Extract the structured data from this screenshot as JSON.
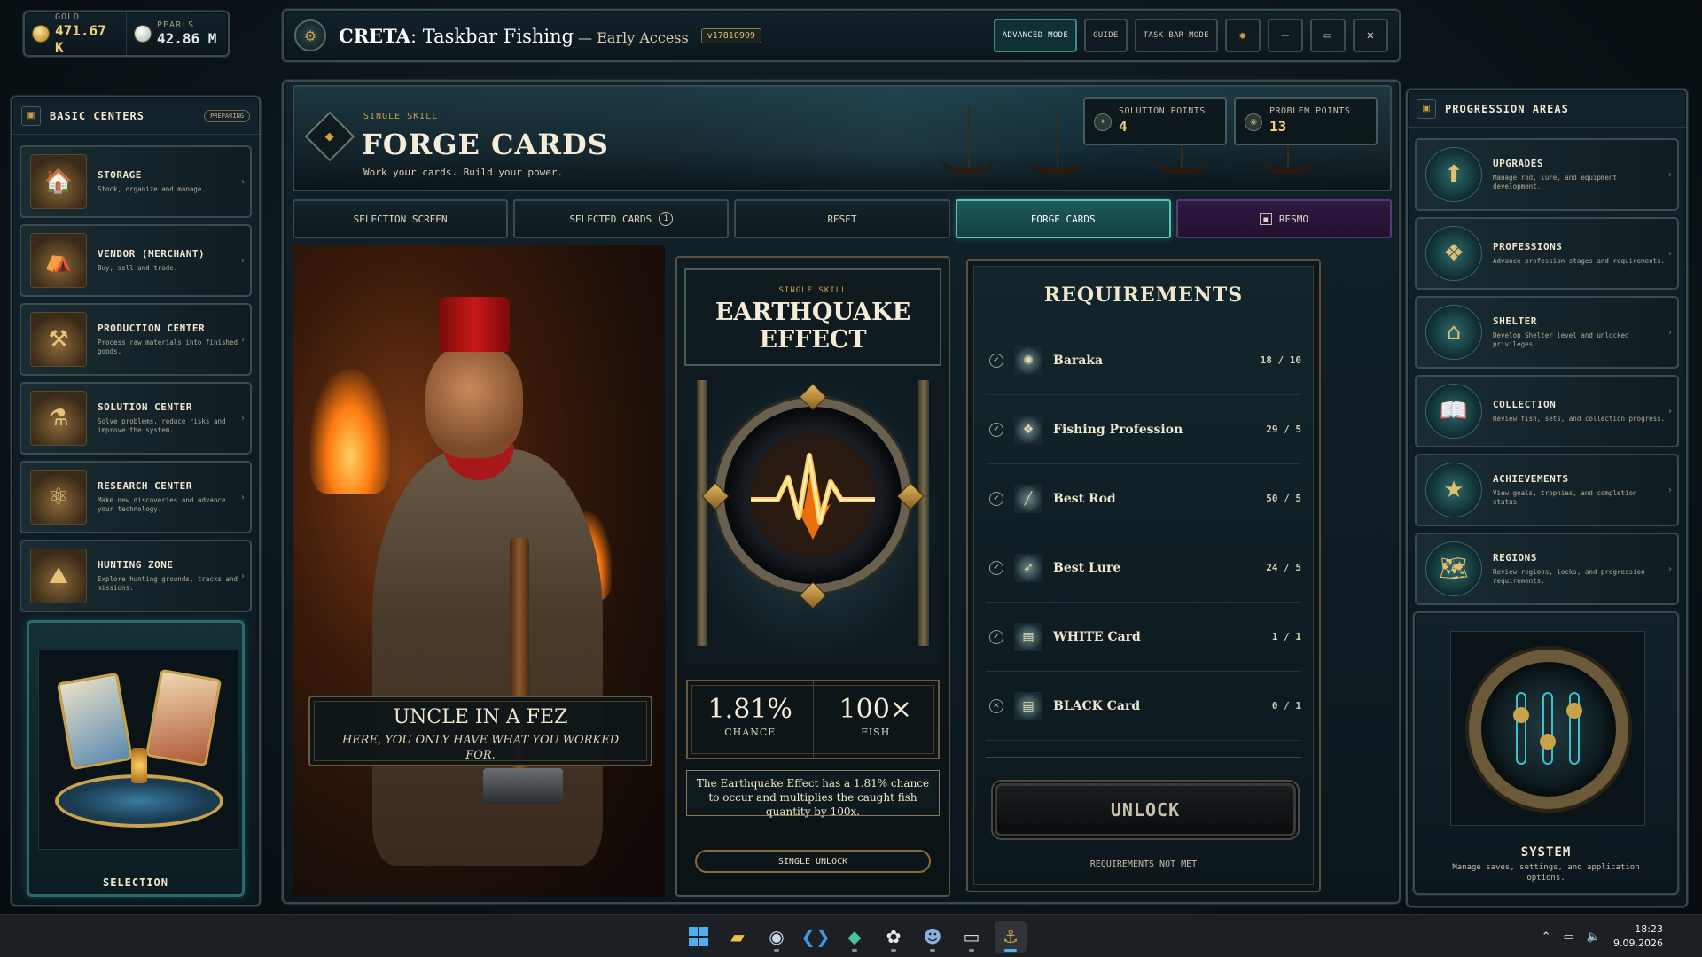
{
  "currency": {
    "gold_label": "GOLD",
    "gold_value": "471.67 K",
    "pearls_label": "PEARLS",
    "pearls_value": "42.86 M"
  },
  "titlebar": {
    "brand": "CRETA",
    "title": ": Taskbar Fishing",
    "subtitle": " — Early Access",
    "version": "v17810909",
    "advanced_mode": "ADVANCED MODE",
    "guide": "GUIDE",
    "task_bar_mode": "TASK BAR MODE",
    "minimize": "—",
    "restore": "▭",
    "close": "✕"
  },
  "left_sidebar": {
    "title": "BASIC CENTERS",
    "badge": "PREPARING",
    "items": [
      {
        "title": "STORAGE",
        "desc": "Stock, organize and manage."
      },
      {
        "title": "VENDOR (MERCHANT)",
        "desc": "Buy, sell and trade."
      },
      {
        "title": "PRODUCTION CENTER",
        "desc": "Process raw materials into finished goods."
      },
      {
        "title": "SOLUTION CENTER",
        "desc": "Solve problems, reduce risks and improve the system."
      },
      {
        "title": "RESEARCH CENTER",
        "desc": "Make new discoveries and advance your technology."
      },
      {
        "title": "HUNTING ZONE",
        "desc": "Explore hunting grounds, tracks and missions."
      }
    ],
    "selection_label": "SELECTION"
  },
  "hero": {
    "kicker": "SINGLE SKILL",
    "title": "FORGE CARDS",
    "subtitle": "Work your cards. Build your power.",
    "solution_points_label": "SOLUTION POINTS",
    "solution_points_value": "4",
    "problem_points_label": "PROBLEM POINTS",
    "problem_points_value": "13"
  },
  "tabs": {
    "selection_screen": "SELECTION SCREEN",
    "selected_cards": "SELECTED CARDS",
    "selected_count": "1",
    "reset": "RESET",
    "forge_cards": "FORGE CARDS",
    "resmo": "RESMO"
  },
  "npc": {
    "name": "UNCLE IN A FEZ",
    "quote": "HERE, YOU ONLY HAVE WHAT YOU WORKED FOR."
  },
  "skill": {
    "kicker": "SINGLE SKILL",
    "title_line1": "EARTHQUAKE",
    "title_line2": "EFFECT",
    "chance_value": "1.81%",
    "chance_label": "CHANCE",
    "fish_value": "100×",
    "fish_label": "FISH",
    "description": "The Earthquake Effect has a 1.81% chance to occur and multiplies the caught fish quantity by 100x.",
    "single_unlock": "SINGLE UNLOCK"
  },
  "requirements": {
    "title": "REQUIREMENTS",
    "items": [
      {
        "name": "Baraka",
        "value": "18 / 10",
        "met": true
      },
      {
        "name": "Fishing Profession",
        "value": "29 / 5",
        "met": true
      },
      {
        "name": "Best Rod",
        "value": "50 / 5",
        "met": true
      },
      {
        "name": "Best Lure",
        "value": "24 / 5",
        "met": true
      },
      {
        "name": "WHITE Card",
        "value": "1 / 1",
        "met": true
      },
      {
        "name": "BLACK Card",
        "value": "0 / 1",
        "met": false
      }
    ],
    "unlock": "UNLOCK",
    "status": "REQUIREMENTS NOT MET"
  },
  "right_sidebar": {
    "title": "PROGRESSION AREAS",
    "items": [
      {
        "title": "UPGRADES",
        "desc": "Manage rod, lure, and equipment development."
      },
      {
        "title": "PROFESSIONS",
        "desc": "Advance profession stages and requirements."
      },
      {
        "title": "SHELTER",
        "desc": "Develop Shelter level and unlocked privileges."
      },
      {
        "title": "COLLECTION",
        "desc": "Review fish, sets, and collection progress."
      },
      {
        "title": "ACHIEVEMENTS",
        "desc": "View goals, trophies, and completion status."
      },
      {
        "title": "REGIONS",
        "desc": "Review regions, locks, and progression requirements."
      }
    ],
    "system_title": "SYSTEM",
    "system_desc": "Manage saves, settings, and application options."
  },
  "taskbar": {
    "time": "18:23",
    "date": "9.09.2026"
  },
  "colors": {
    "accent": "#5ac0b8",
    "gold": "#f0c56a",
    "purple_tab": "#2e1a44"
  }
}
